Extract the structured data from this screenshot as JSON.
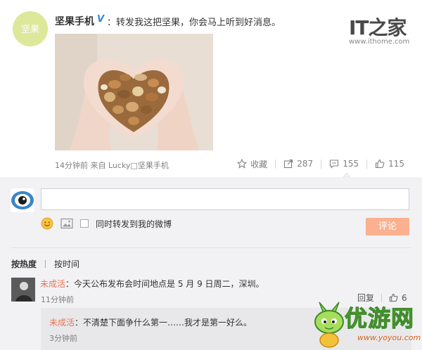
{
  "post": {
    "avatar_text": "坚果",
    "username": "坚果手机",
    "verified_mark": "V",
    "text": "：转发我这把坚果，你会马上听到好消息。",
    "image_label": "hands holding mixed nuts",
    "meta": "14分钟前 来自 Lucky□坚果手机"
  },
  "brand": {
    "logo": "IT之家",
    "url": "www.ithome.com"
  },
  "actions": {
    "favorite": "收藏",
    "forward_count": "287",
    "comment_count": "155",
    "like_count": "115"
  },
  "comment_box": {
    "placeholder": "",
    "sync_label": "同时转发到我的微博",
    "submit_label": "评论"
  },
  "sort": {
    "hot": "按热度",
    "time": "按时间"
  },
  "comments": [
    {
      "user": "未成活",
      "text": "：今天公布发布会时间地点是 5 月 9 日周二，深圳。",
      "time": "11分钟前",
      "reply_label": "回复",
      "likes": "6"
    },
    {
      "user": "未成活",
      "text": "：不清楚下面争什么第一……我才是第一好么。",
      "time": "3分钟前"
    }
  ],
  "watermark": {
    "text": "优游网",
    "url": "www.yoyou.com"
  },
  "colors": {
    "accent": "#eb7350",
    "button": "#fbb08f",
    "verified": "#2d86d8",
    "panel": "#f2f2f5"
  }
}
